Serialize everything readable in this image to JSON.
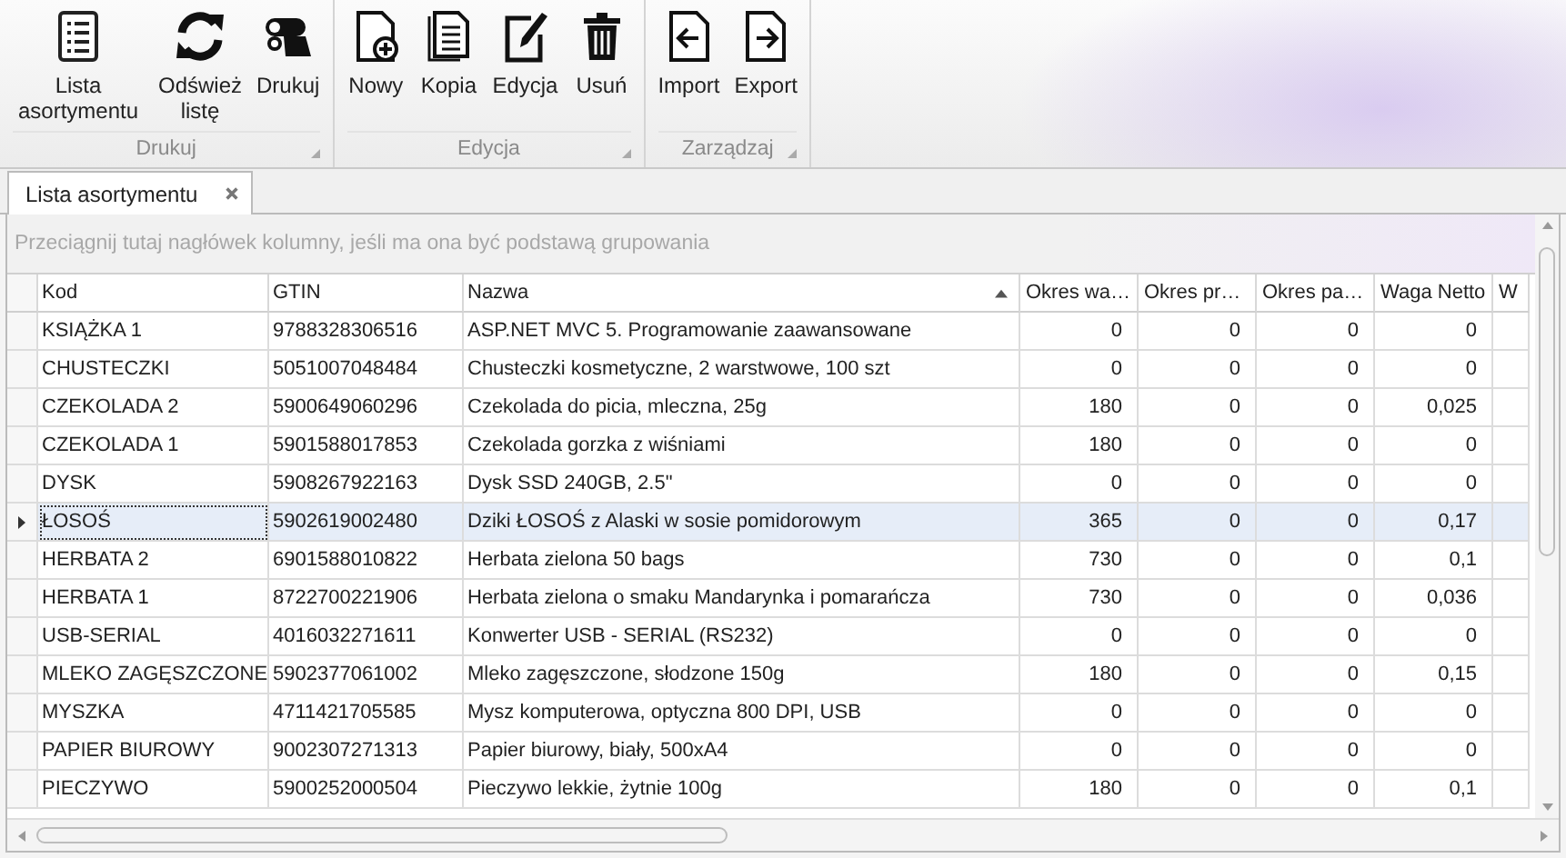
{
  "ribbon": {
    "groups": [
      {
        "label": "Drukuj",
        "buttons": [
          {
            "label": "Lista asortymentu",
            "kind": "list"
          },
          {
            "label": "Odśwież listę",
            "kind": "refresh"
          },
          {
            "label": "Drukuj",
            "kind": "print"
          }
        ]
      },
      {
        "label": "Edycja",
        "buttons": [
          {
            "label": "Nowy",
            "kind": "new"
          },
          {
            "label": "Kopia",
            "kind": "copy"
          },
          {
            "label": "Edycja",
            "kind": "edit"
          },
          {
            "label": "Usuń",
            "kind": "delete"
          }
        ]
      },
      {
        "label": "Zarządzaj",
        "buttons": [
          {
            "label": "Import",
            "kind": "import"
          },
          {
            "label": "Export",
            "kind": "export"
          }
        ]
      }
    ]
  },
  "tabs": [
    {
      "label": "Lista asortymentu",
      "selected": true
    }
  ],
  "grid": {
    "group_panel_hint": "Przeciągnij tutaj nagłówek kolumny, jeśli ma ona być podstawą grupowania",
    "columns": [
      {
        "label": "Kod",
        "kind": "text",
        "sorted": false
      },
      {
        "label": "GTIN",
        "kind": "text",
        "sorted": false
      },
      {
        "label": "Nazwa",
        "kind": "text",
        "sorted": true
      },
      {
        "label": "Okres wa…",
        "kind": "number",
        "sorted": false
      },
      {
        "label": "Okres pr…",
        "kind": "number",
        "sorted": false
      },
      {
        "label": "Okres pa…",
        "kind": "number",
        "sorted": false
      },
      {
        "label": "Waga Netto",
        "kind": "number",
        "sorted": false
      },
      {
        "label": "W",
        "kind": "number",
        "sorted": false
      }
    ],
    "rows": [
      {
        "selected": false,
        "cells": [
          "KSIĄŻKA 1",
          "9788328306516",
          "ASP.NET MVC 5. Programowanie zaawansowane",
          "0",
          "0",
          "0",
          "0"
        ]
      },
      {
        "selected": false,
        "cells": [
          "CHUSTECZKI",
          "5051007048484",
          "Chusteczki kosmetyczne, 2 warstwowe, 100 szt",
          "0",
          "0",
          "0",
          "0"
        ]
      },
      {
        "selected": false,
        "cells": [
          "CZEKOLADA 2",
          "5900649060296",
          "Czekolada do picia, mleczna, 25g",
          "180",
          "0",
          "0",
          "0,025"
        ]
      },
      {
        "selected": false,
        "cells": [
          "CZEKOLADA 1",
          "5901588017853",
          "Czekolada gorzka z wiśniami",
          "180",
          "0",
          "0",
          "0"
        ]
      },
      {
        "selected": false,
        "cells": [
          "DYSK",
          "5908267922163",
          "Dysk SSD 240GB, 2.5\"",
          "0",
          "0",
          "0",
          "0"
        ]
      },
      {
        "selected": true,
        "cells": [
          "ŁOSOŚ",
          "5902619002480",
          "Dziki ŁOSOŚ z Alaski w sosie pomidorowym",
          "365",
          "0",
          "0",
          "0,17"
        ]
      },
      {
        "selected": false,
        "cells": [
          "HERBATA 2",
          "6901588010822",
          "Herbata zielona 50 bags",
          "730",
          "0",
          "0",
          "0,1"
        ]
      },
      {
        "selected": false,
        "cells": [
          "HERBATA 1",
          "8722700221906",
          "Herbata zielona o smaku Mandarynka i pomarańcza",
          "730",
          "0",
          "0",
          "0,036"
        ]
      },
      {
        "selected": false,
        "cells": [
          "USB-SERIAL",
          "4016032271611",
          "Konwerter USB - SERIAL (RS232)",
          "0",
          "0",
          "0",
          "0"
        ]
      },
      {
        "selected": false,
        "cells": [
          "MLEKO ZAGĘSZCZONE",
          "5902377061002",
          "Mleko zagęszczone, słodzone 150g",
          "180",
          "0",
          "0",
          "0,15"
        ]
      },
      {
        "selected": false,
        "cells": [
          "MYSZKA",
          "4711421705585",
          "Mysz komputerowa, optyczna 800 DPI, USB",
          "0",
          "0",
          "0",
          "0"
        ]
      },
      {
        "selected": false,
        "cells": [
          "PAPIER BIUROWY",
          "9002307271313",
          "Papier biurowy, biały, 500xA4",
          "0",
          "0",
          "0",
          "0"
        ]
      },
      {
        "selected": false,
        "cells": [
          "PIECZYWO",
          "5900252000504",
          "Pieczywo lekkie, żytnie 100g",
          "180",
          "0",
          "0",
          "0,1"
        ]
      }
    ]
  }
}
